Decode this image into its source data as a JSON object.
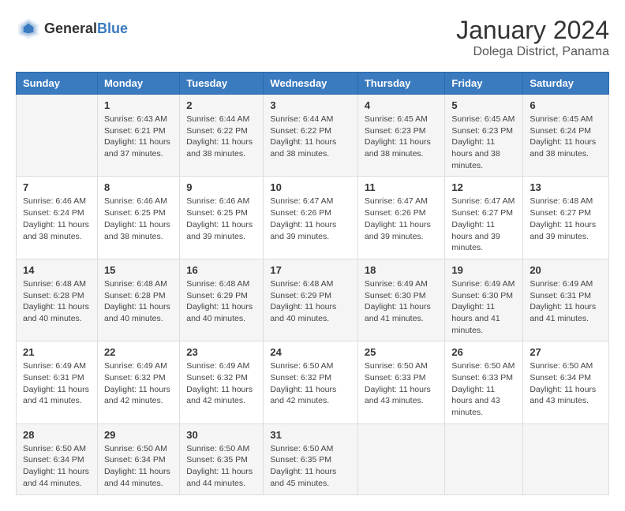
{
  "logo": {
    "general": "General",
    "blue": "Blue"
  },
  "title": "January 2024",
  "subtitle": "Dolega District, Panama",
  "days_of_week": [
    "Sunday",
    "Monday",
    "Tuesday",
    "Wednesday",
    "Thursday",
    "Friday",
    "Saturday"
  ],
  "weeks": [
    [
      {
        "day": "",
        "sunrise": "",
        "sunset": "",
        "daylight": ""
      },
      {
        "day": "1",
        "sunrise": "Sunrise: 6:43 AM",
        "sunset": "Sunset: 6:21 PM",
        "daylight": "Daylight: 11 hours and 37 minutes."
      },
      {
        "day": "2",
        "sunrise": "Sunrise: 6:44 AM",
        "sunset": "Sunset: 6:22 PM",
        "daylight": "Daylight: 11 hours and 38 minutes."
      },
      {
        "day": "3",
        "sunrise": "Sunrise: 6:44 AM",
        "sunset": "Sunset: 6:22 PM",
        "daylight": "Daylight: 11 hours and 38 minutes."
      },
      {
        "day": "4",
        "sunrise": "Sunrise: 6:45 AM",
        "sunset": "Sunset: 6:23 PM",
        "daylight": "Daylight: 11 hours and 38 minutes."
      },
      {
        "day": "5",
        "sunrise": "Sunrise: 6:45 AM",
        "sunset": "Sunset: 6:23 PM",
        "daylight": "Daylight: 11 hours and 38 minutes."
      },
      {
        "day": "6",
        "sunrise": "Sunrise: 6:45 AM",
        "sunset": "Sunset: 6:24 PM",
        "daylight": "Daylight: 11 hours and 38 minutes."
      }
    ],
    [
      {
        "day": "7",
        "sunrise": "Sunrise: 6:46 AM",
        "sunset": "Sunset: 6:24 PM",
        "daylight": "Daylight: 11 hours and 38 minutes."
      },
      {
        "day": "8",
        "sunrise": "Sunrise: 6:46 AM",
        "sunset": "Sunset: 6:25 PM",
        "daylight": "Daylight: 11 hours and 38 minutes."
      },
      {
        "day": "9",
        "sunrise": "Sunrise: 6:46 AM",
        "sunset": "Sunset: 6:25 PM",
        "daylight": "Daylight: 11 hours and 39 minutes."
      },
      {
        "day": "10",
        "sunrise": "Sunrise: 6:47 AM",
        "sunset": "Sunset: 6:26 PM",
        "daylight": "Daylight: 11 hours and 39 minutes."
      },
      {
        "day": "11",
        "sunrise": "Sunrise: 6:47 AM",
        "sunset": "Sunset: 6:26 PM",
        "daylight": "Daylight: 11 hours and 39 minutes."
      },
      {
        "day": "12",
        "sunrise": "Sunrise: 6:47 AM",
        "sunset": "Sunset: 6:27 PM",
        "daylight": "Daylight: 11 hours and 39 minutes."
      },
      {
        "day": "13",
        "sunrise": "Sunrise: 6:48 AM",
        "sunset": "Sunset: 6:27 PM",
        "daylight": "Daylight: 11 hours and 39 minutes."
      }
    ],
    [
      {
        "day": "14",
        "sunrise": "Sunrise: 6:48 AM",
        "sunset": "Sunset: 6:28 PM",
        "daylight": "Daylight: 11 hours and 40 minutes."
      },
      {
        "day": "15",
        "sunrise": "Sunrise: 6:48 AM",
        "sunset": "Sunset: 6:28 PM",
        "daylight": "Daylight: 11 hours and 40 minutes."
      },
      {
        "day": "16",
        "sunrise": "Sunrise: 6:48 AM",
        "sunset": "Sunset: 6:29 PM",
        "daylight": "Daylight: 11 hours and 40 minutes."
      },
      {
        "day": "17",
        "sunrise": "Sunrise: 6:48 AM",
        "sunset": "Sunset: 6:29 PM",
        "daylight": "Daylight: 11 hours and 40 minutes."
      },
      {
        "day": "18",
        "sunrise": "Sunrise: 6:49 AM",
        "sunset": "Sunset: 6:30 PM",
        "daylight": "Daylight: 11 hours and 41 minutes."
      },
      {
        "day": "19",
        "sunrise": "Sunrise: 6:49 AM",
        "sunset": "Sunset: 6:30 PM",
        "daylight": "Daylight: 11 hours and 41 minutes."
      },
      {
        "day": "20",
        "sunrise": "Sunrise: 6:49 AM",
        "sunset": "Sunset: 6:31 PM",
        "daylight": "Daylight: 11 hours and 41 minutes."
      }
    ],
    [
      {
        "day": "21",
        "sunrise": "Sunrise: 6:49 AM",
        "sunset": "Sunset: 6:31 PM",
        "daylight": "Daylight: 11 hours and 41 minutes."
      },
      {
        "day": "22",
        "sunrise": "Sunrise: 6:49 AM",
        "sunset": "Sunset: 6:32 PM",
        "daylight": "Daylight: 11 hours and 42 minutes."
      },
      {
        "day": "23",
        "sunrise": "Sunrise: 6:49 AM",
        "sunset": "Sunset: 6:32 PM",
        "daylight": "Daylight: 11 hours and 42 minutes."
      },
      {
        "day": "24",
        "sunrise": "Sunrise: 6:50 AM",
        "sunset": "Sunset: 6:32 PM",
        "daylight": "Daylight: 11 hours and 42 minutes."
      },
      {
        "day": "25",
        "sunrise": "Sunrise: 6:50 AM",
        "sunset": "Sunset: 6:33 PM",
        "daylight": "Daylight: 11 hours and 43 minutes."
      },
      {
        "day": "26",
        "sunrise": "Sunrise: 6:50 AM",
        "sunset": "Sunset: 6:33 PM",
        "daylight": "Daylight: 11 hours and 43 minutes."
      },
      {
        "day": "27",
        "sunrise": "Sunrise: 6:50 AM",
        "sunset": "Sunset: 6:34 PM",
        "daylight": "Daylight: 11 hours and 43 minutes."
      }
    ],
    [
      {
        "day": "28",
        "sunrise": "Sunrise: 6:50 AM",
        "sunset": "Sunset: 6:34 PM",
        "daylight": "Daylight: 11 hours and 44 minutes."
      },
      {
        "day": "29",
        "sunrise": "Sunrise: 6:50 AM",
        "sunset": "Sunset: 6:34 PM",
        "daylight": "Daylight: 11 hours and 44 minutes."
      },
      {
        "day": "30",
        "sunrise": "Sunrise: 6:50 AM",
        "sunset": "Sunset: 6:35 PM",
        "daylight": "Daylight: 11 hours and 44 minutes."
      },
      {
        "day": "31",
        "sunrise": "Sunrise: 6:50 AM",
        "sunset": "Sunset: 6:35 PM",
        "daylight": "Daylight: 11 hours and 45 minutes."
      },
      {
        "day": "",
        "sunrise": "",
        "sunset": "",
        "daylight": ""
      },
      {
        "day": "",
        "sunrise": "",
        "sunset": "",
        "daylight": ""
      },
      {
        "day": "",
        "sunrise": "",
        "sunset": "",
        "daylight": ""
      }
    ]
  ]
}
